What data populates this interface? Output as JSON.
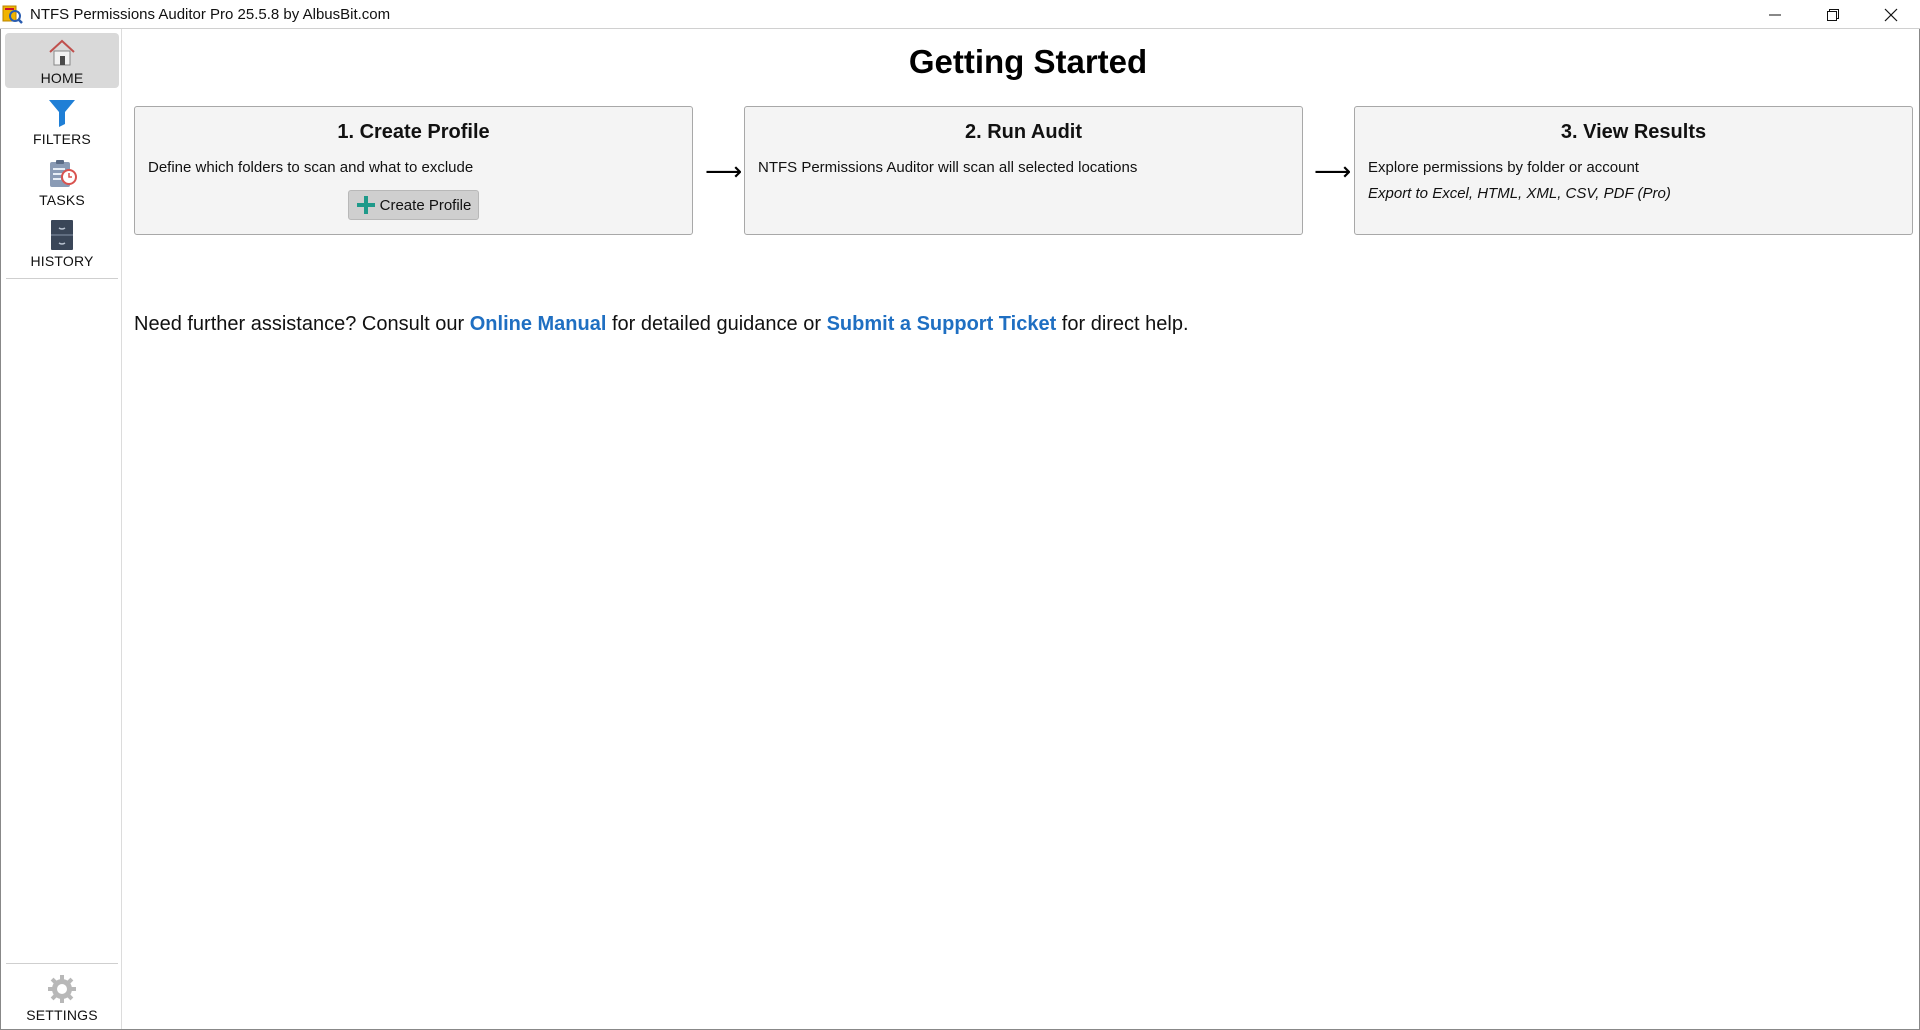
{
  "window": {
    "title": "NTFS Permissions Auditor Pro 25.5.8 by AlbusBit.com"
  },
  "sidebar": {
    "items": [
      {
        "label": "HOME",
        "icon": "home-icon",
        "active": true
      },
      {
        "label": "FILTERS",
        "icon": "funnel-icon",
        "active": false
      },
      {
        "label": "TASKS",
        "icon": "clipboard-clock-icon",
        "active": false
      },
      {
        "label": "HISTORY",
        "icon": "file-cabinet-icon",
        "active": false
      }
    ],
    "settings": {
      "label": "SETTINGS",
      "icon": "gear-icon"
    }
  },
  "main": {
    "title": "Getting Started",
    "steps": [
      {
        "title": "1. Create Profile",
        "description": "Define which folders to scan and what to exclude",
        "button_label": "Create Profile"
      },
      {
        "title": "2. Run Audit",
        "description": "NTFS Permissions Auditor will scan all selected locations"
      },
      {
        "title": "3. View Results",
        "description": "Explore permissions by folder or account",
        "description2": "Export to Excel, HTML, XML, CSV, PDF (Pro)"
      }
    ],
    "arrow": "⟶",
    "help": {
      "prefix": "Need further assistance? Consult our ",
      "manual_link": "Online Manual",
      "middle": " for detailed guidance or ",
      "ticket_link": "Submit a Support Ticket",
      "suffix": " for direct help."
    }
  },
  "colors": {
    "link": "#1f6fc2",
    "active_nav": "#d9d9d9",
    "card_bg": "#f4f4f4",
    "plus": "#1e9a8a"
  }
}
